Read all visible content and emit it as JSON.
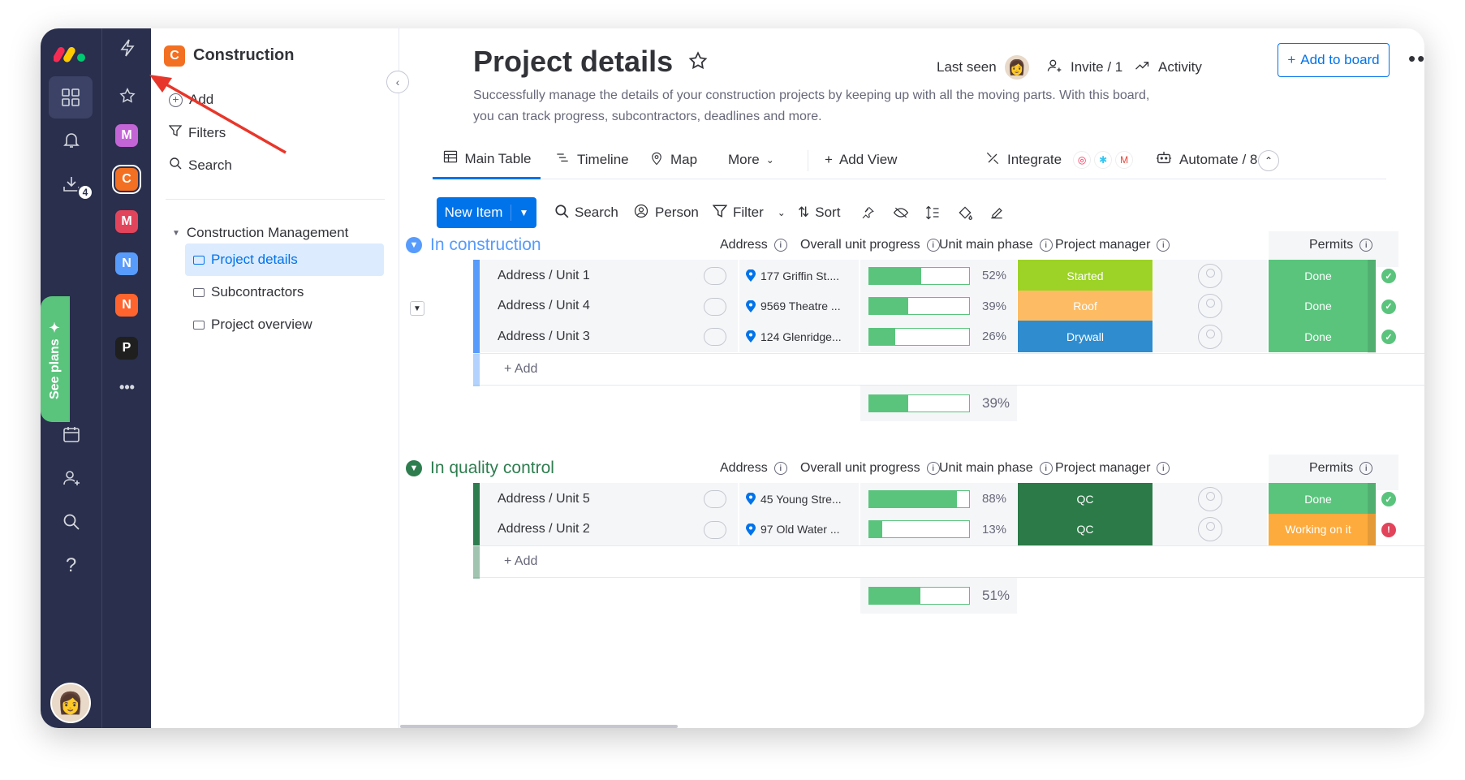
{
  "workspace": {
    "name": "Construction",
    "logo_letter": "C",
    "menu": {
      "add": "Add",
      "filters": "Filters",
      "search": "Search"
    },
    "folder": "Construction Management",
    "boards": [
      "Project details",
      "Subcontractors",
      "Project overview"
    ]
  },
  "rail": {
    "see_plans": "See plans",
    "badge": "4",
    "workspaces": [
      "M",
      "C",
      "M",
      "N",
      "N",
      "P"
    ],
    "more": "•••"
  },
  "board": {
    "title": "Project details",
    "description": "Successfully manage the details of your construction projects by keeping up with all the moving parts. With this board, you can track progress, subcontractors, deadlines and more.",
    "last_seen": "Last seen",
    "invite": "Invite / 1",
    "activity": "Activity",
    "add_to_board": "Add to board"
  },
  "tabs": [
    "Main Table",
    "Timeline",
    "Map",
    "More",
    "Add View"
  ],
  "integrations": {
    "integrate": "Integrate",
    "automate": "Automate / 8"
  },
  "toolbar": {
    "new_item": "New Item",
    "search": "Search",
    "person": "Person",
    "filter": "Filter",
    "sort": "Sort"
  },
  "columns": [
    "Address",
    "Overall unit progress",
    "Unit main phase",
    "Project manager",
    "Permits"
  ],
  "groups": [
    {
      "title": "In construction",
      "color": "#579bfc",
      "rows": [
        {
          "name": "Address / Unit 1",
          "address": "177 Griffin St....",
          "progress": 52,
          "progress_label": "52%",
          "phase": "Started",
          "phase_color": "#9cd326",
          "permit": "Done",
          "permit_color": "#5ac47d"
        },
        {
          "name": "Address / Unit 4",
          "address": "9569 Theatre ...",
          "progress": 39,
          "progress_label": "39%",
          "phase": "Roof",
          "phase_color": "#fdbc64",
          "permit": "Done",
          "permit_color": "#5ac47d"
        },
        {
          "name": "Address / Unit 3",
          "address": "124 Glenridge...",
          "progress": 26,
          "progress_label": "26%",
          "phase": "Drywall",
          "phase_color": "#2e8ccf",
          "permit": "Done",
          "permit_color": "#5ac47d"
        }
      ],
      "add_label": "+ Add",
      "summary": 39,
      "summary_label": "39%"
    },
    {
      "title": "In quality control",
      "color": "#2e7d4f",
      "rows": [
        {
          "name": "Address / Unit 5",
          "address": "45 Young Stre...",
          "progress": 88,
          "progress_label": "88%",
          "phase": "QC",
          "phase_color": "#2b7a47",
          "permit": "Done",
          "permit_color": "#5ac47d"
        },
        {
          "name": "Address / Unit 2",
          "address": "97 Old Water ...",
          "progress": 13,
          "progress_label": "13%",
          "phase": "QC",
          "phase_color": "#2b7a47",
          "permit": "Working on it",
          "permit_color": "#fdab3d"
        }
      ],
      "add_label": "+ Add",
      "summary": 51,
      "summary_label": "51%"
    }
  ]
}
